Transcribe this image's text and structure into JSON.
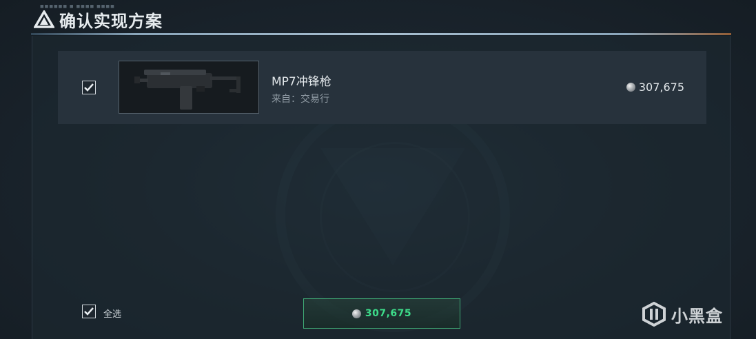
{
  "header": {
    "title": "确认实现方案",
    "tiny_text": "■■■■■■ ■ ■■■■ ■■■■"
  },
  "items": [
    {
      "checked": true,
      "name": "MP7冲锋枪",
      "source": "来自：交易行",
      "price": "307,675",
      "icon": "mp7-gun-thumbnail"
    }
  ],
  "footer": {
    "select_all_label": "全选",
    "select_all_checked": true,
    "total_price": "307,675"
  },
  "watermark": {
    "text": "小黑盒"
  },
  "colors": {
    "accent_green": "#3ddc8a",
    "background": "#18222b",
    "row_background": "#27323c"
  }
}
